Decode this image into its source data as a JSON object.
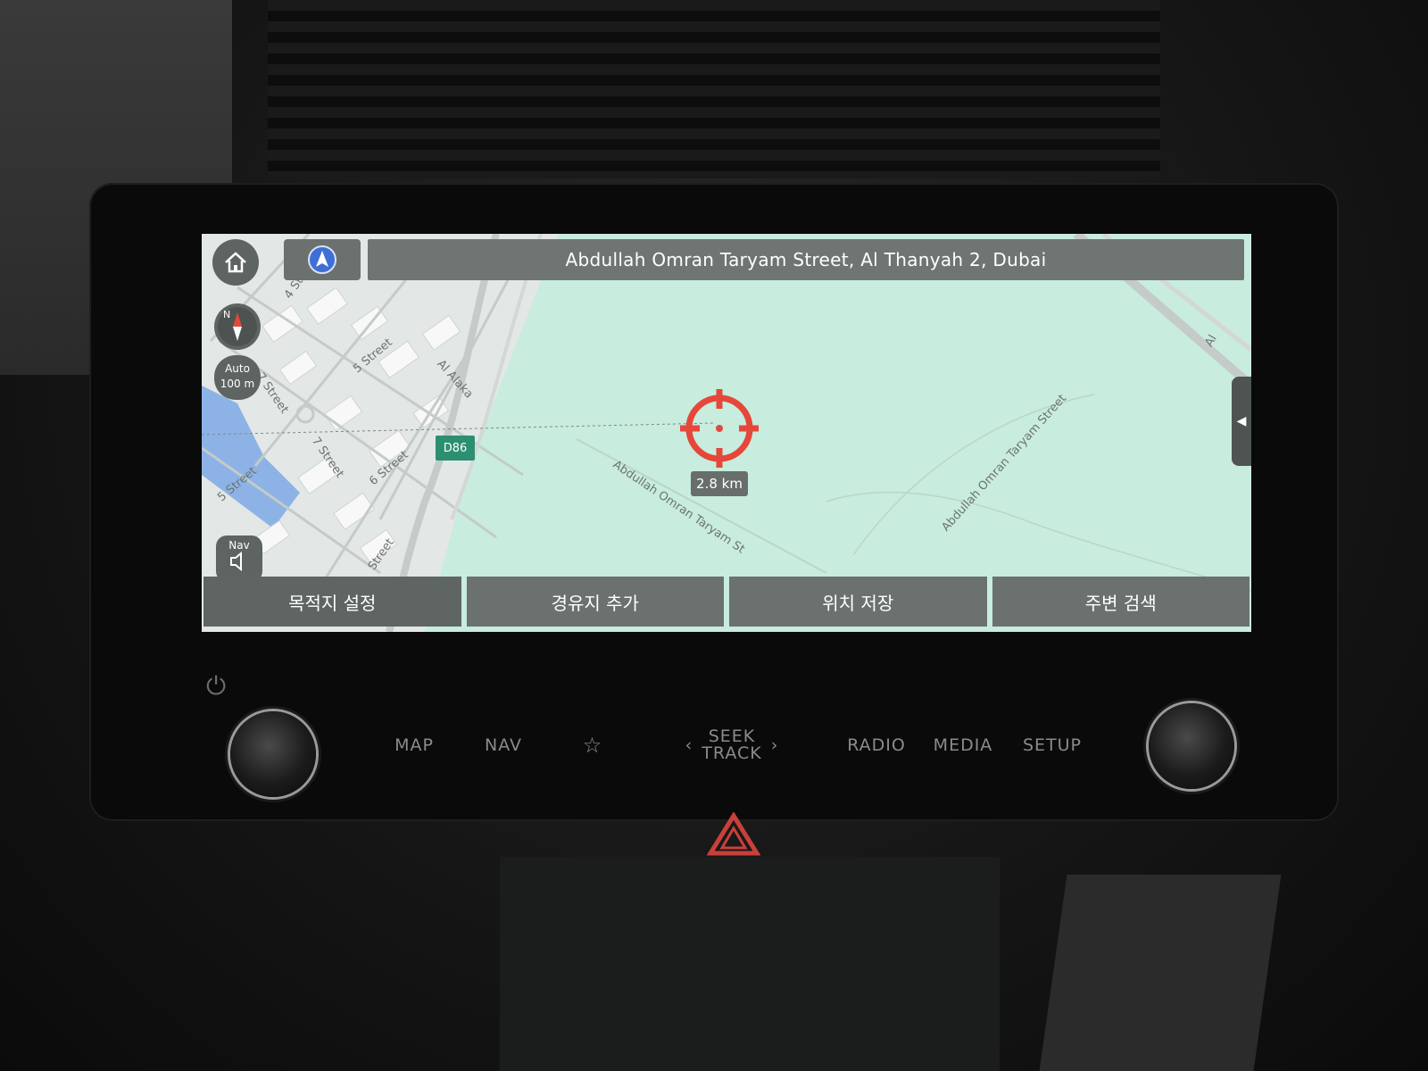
{
  "header": {
    "address": "Abdullah Omran Taryam Street, Al Thanyah 2, Dubai"
  },
  "map": {
    "scale_mode": "Auto",
    "scale_value": "100 m",
    "compass_label": "N",
    "route_badge": "D86",
    "cursor_distance": "2.8 km",
    "nav_volume_label": "Nav",
    "street_labels": [
      "4 St",
      "5 Street",
      "Al Alaka",
      "7 Street",
      "7 Street",
      "6 Street",
      "5 Street",
      "Street",
      "Abdullah Omran Taryam St",
      "Abdullah Omran Taryam Street",
      "Al",
      "eet"
    ]
  },
  "actions": {
    "set_destination": "목적지 설정",
    "add_waypoint": "경유지 추가",
    "save_location": "위치 저장",
    "nearby_search": "주변 검색"
  },
  "hardware_buttons": {
    "map": "MAP",
    "nav": "NAV",
    "seek": "SEEK",
    "track": "TRACK",
    "radio": "RADIO",
    "media": "MEDIA",
    "setup": "SETUP"
  },
  "colors": {
    "map_land": "#c8ecdd",
    "map_urban": "#e3e7e5",
    "water": "#7ea9e6",
    "crosshair": "#e5473b",
    "button_gray": "#6b716f"
  },
  "icons": {
    "home": "home-icon",
    "nav_arrow": "navigation-arrow-icon",
    "compass": "compass-icon",
    "speaker": "speaker-icon",
    "crosshair": "crosshair-icon",
    "favorite": "star-icon",
    "hazard": "hazard-triangle-icon",
    "power": "power-icon"
  }
}
